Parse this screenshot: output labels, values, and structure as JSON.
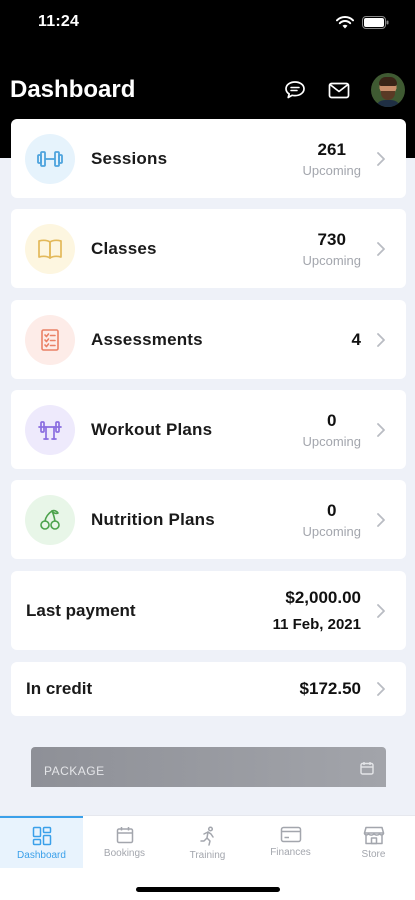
{
  "status_bar": {
    "time": "11:24"
  },
  "header": {
    "title": "Dashboard"
  },
  "cards": [
    {
      "label": "Sessions",
      "value": "261",
      "sub": "Upcoming",
      "icon": "dumbbell-icon",
      "icon_bg": "#e6f3fc",
      "icon_color": "#4da3dd"
    },
    {
      "label": "Classes",
      "value": "730",
      "sub": "Upcoming",
      "icon": "book-icon",
      "icon_bg": "#fdf6e0",
      "icon_color": "#e3b95a"
    },
    {
      "label": "Assessments",
      "value": "4",
      "sub": "",
      "icon": "checklist-icon",
      "icon_bg": "#fdece8",
      "icon_color": "#ea8065"
    },
    {
      "label": "Workout Plans",
      "value": "0",
      "sub": "Upcoming",
      "icon": "barbell-rack-icon",
      "icon_bg": "#eeeafc",
      "icon_color": "#8a6ee0"
    },
    {
      "label": "Nutrition Plans",
      "value": "0",
      "sub": "Upcoming",
      "icon": "cherries-icon",
      "icon_bg": "#e8f6e8",
      "icon_color": "#4ca24c"
    }
  ],
  "last_payment": {
    "label": "Last payment",
    "amount": "$2,000.00",
    "date": "11 Feb, 2021"
  },
  "credit": {
    "label": "In credit",
    "amount": "$172.50"
  },
  "package": {
    "label": "PACKAGE"
  },
  "tabs": [
    {
      "label": "Dashboard",
      "icon": "dashboard-icon",
      "active": true
    },
    {
      "label": "Bookings",
      "icon": "calendar-icon",
      "active": false
    },
    {
      "label": "Training",
      "icon": "running-icon",
      "active": false
    },
    {
      "label": "Finances",
      "icon": "credit-card-icon",
      "active": false
    },
    {
      "label": "Store",
      "icon": "store-icon",
      "active": false
    }
  ],
  "colors": {
    "accent": "#3aa0ea",
    "header_bg": "#000000",
    "page_bg": "#eef1f8"
  }
}
